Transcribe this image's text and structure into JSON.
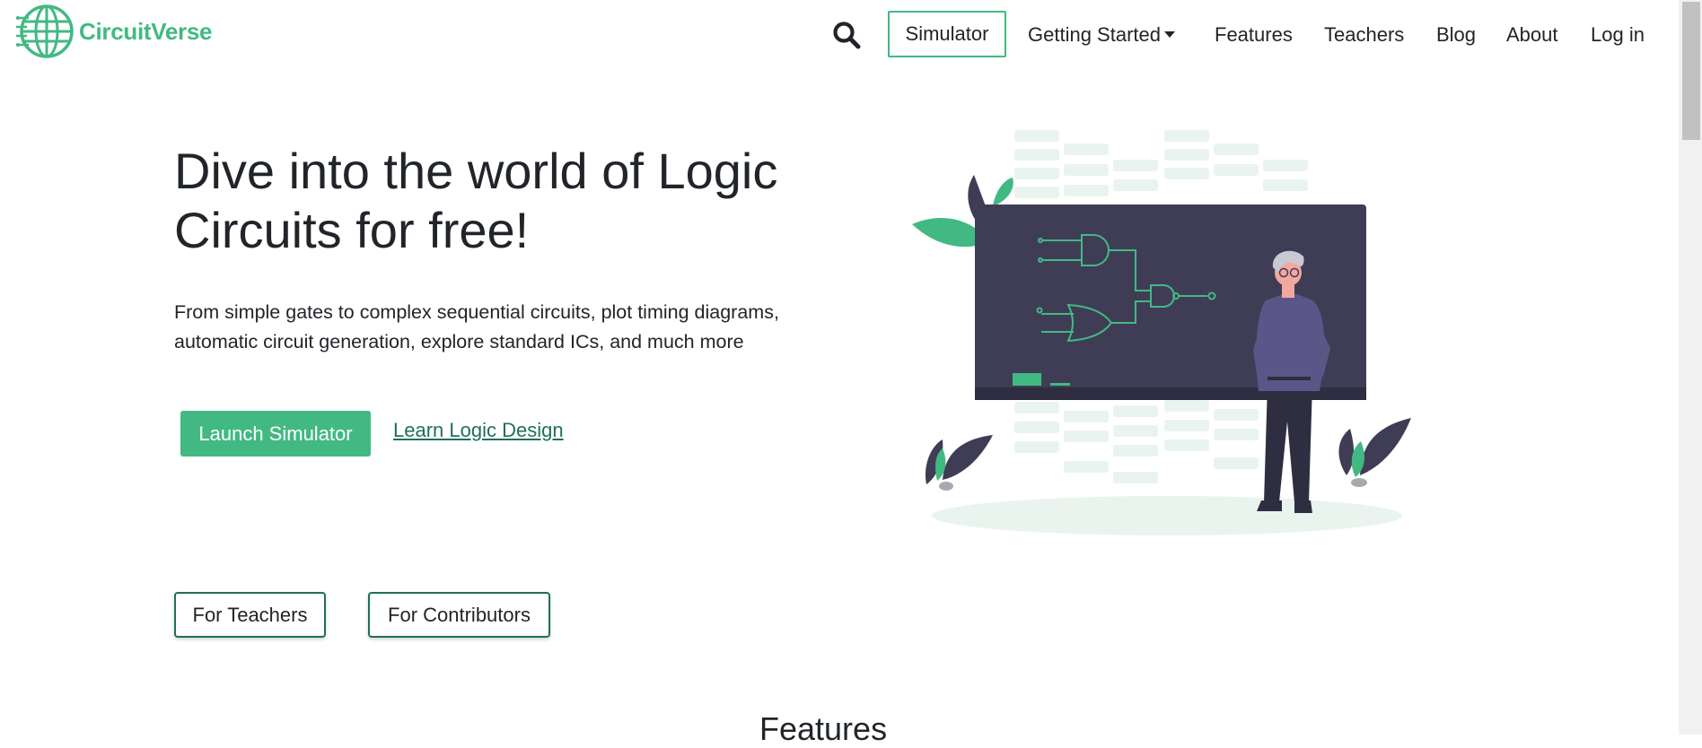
{
  "brand": {
    "name": "CircuitVerse",
    "color": "#42b983",
    "logo_icon": "globe-circuit-logo"
  },
  "nav": {
    "search_icon": "magnifier",
    "simulator_label": "Simulator",
    "getting_started_label": "Getting Started",
    "features_label": "Features",
    "teachers_label": "Teachers",
    "blog_label": "Blog",
    "about_label": "About",
    "login_label": "Log in"
  },
  "hero": {
    "title": "Dive into the world of Logic Circuits for free!",
    "subtitle": "From simple gates to complex sequential circuits, plot timing diagrams, automatic circuit generation, explore standard ICs, and much more",
    "launch_label": "Launch Simulator",
    "learn_label": "Learn Logic Design"
  },
  "audience_buttons": {
    "teachers_label": "For Teachers",
    "contributors_label": "For Contributors"
  },
  "features_heading": "Features",
  "colors": {
    "accent": "#42b983",
    "link_dark": "#1f6f5c",
    "board": "#3f3d56",
    "text": "#212529"
  }
}
